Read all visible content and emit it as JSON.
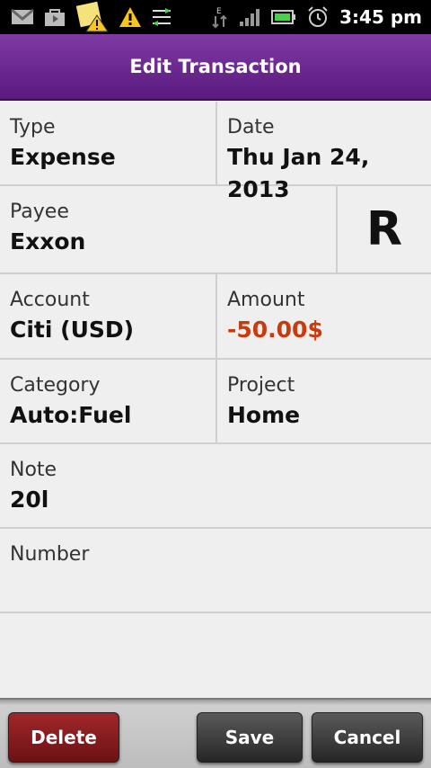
{
  "status_bar": {
    "time": "3:45 pm",
    "icons": [
      "gmail-icon",
      "market-icon",
      "note-warning-icon",
      "warning-icon",
      "sync-icon",
      "data-edge-icon",
      "signal-icon",
      "battery-icon",
      "alarm-icon"
    ]
  },
  "title": "Edit Transaction",
  "form": {
    "type": {
      "label": "Type",
      "value": "Expense"
    },
    "date": {
      "label": "Date",
      "value": "Thu Jan 24, 2013"
    },
    "payee": {
      "label": "Payee",
      "value": "Exxon"
    },
    "reconcile": {
      "value": "R"
    },
    "account": {
      "label": "Account",
      "value": "Citi (USD)"
    },
    "amount": {
      "label": "Amount",
      "value": "-50.00$",
      "color": "#c93a0c"
    },
    "category": {
      "label": "Category",
      "value": "Auto:Fuel"
    },
    "project": {
      "label": "Project",
      "value": "Home"
    },
    "note": {
      "label": "Note",
      "value": "20l"
    },
    "number": {
      "label": "Number",
      "value": ""
    }
  },
  "buttons": {
    "delete": "Delete",
    "save": "Save",
    "cancel": "Cancel"
  }
}
